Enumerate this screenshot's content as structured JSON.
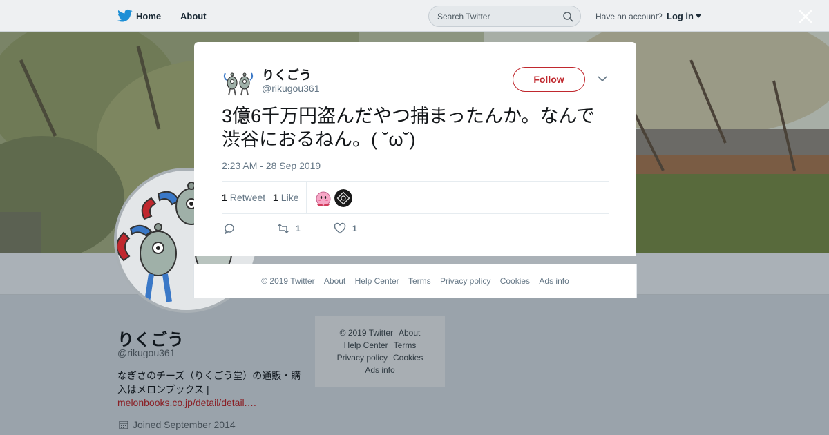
{
  "topbar": {
    "home_label": "Home",
    "about_label": "About",
    "search_placeholder": "Search Twitter",
    "have_account": "Have an account?",
    "login_label": "Log in",
    "brand_color": "#1da1f2"
  },
  "profile": {
    "name": "りくごう",
    "handle": "@rikugou361",
    "bio": "なぎさのチーズ（りくごう堂）の通販・購入はメロンブックス |",
    "link": "melonbooks.co.jp/detail/detail.…",
    "joined": "Joined September 2014"
  },
  "side_footer": {
    "row1": [
      "© 2019 Twitter",
      "About"
    ],
    "row2": [
      "Help Center",
      "Terms"
    ],
    "row3": [
      "Privacy policy",
      "Cookies"
    ],
    "row4": [
      "Ads info"
    ]
  },
  "tweet": {
    "author_name": "りくごう",
    "author_handle": "@rikugou361",
    "follow_label": "Follow",
    "text": "3億6千万円盗んだやつ捕まったんか。なんで渋谷におるねん。( ˘ω˘)",
    "timestamp": "2:23 AM - 28 Sep 2019",
    "retweet_count": "1",
    "retweet_label": "Retweet",
    "like_count": "1",
    "like_label": "Like",
    "action_retweet_count": "1",
    "action_like_count": "1",
    "accent_color": "#c0282e"
  },
  "modal_footer": [
    "© 2019 Twitter",
    "About",
    "Help Center",
    "Terms",
    "Privacy policy",
    "Cookies",
    "Ads info"
  ]
}
